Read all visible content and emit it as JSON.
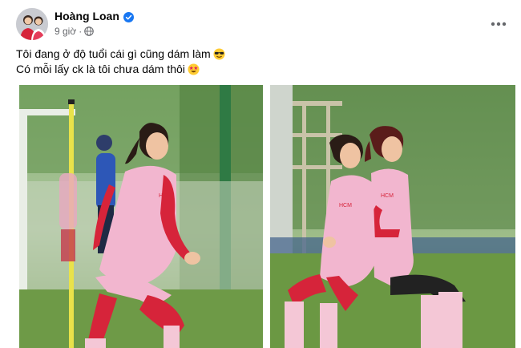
{
  "post": {
    "author_name": "Hoàng Loan",
    "time_label": "9 giờ",
    "caption_lines": [
      "Tôi đang ở độ tuổi cái gì cũng dám làm",
      "Có mỗi lấy ck là tôi chưa dám thôi"
    ],
    "caption_emojis": [
      "smiling-face-with-sunglasses",
      "star-struck"
    ],
    "photos": [
      {
        "subject": "player-running-in-pink-kit"
      },
      {
        "subject": "two-players-lunging-in-pink-kit"
      }
    ]
  },
  "colors": {
    "verified_blue": "#1877f2",
    "meta_gray": "#65676b",
    "kit_pink": "#f2b6cf",
    "sleeve_red": "#d6243a",
    "pitch_green": "#6f9a4f"
  }
}
